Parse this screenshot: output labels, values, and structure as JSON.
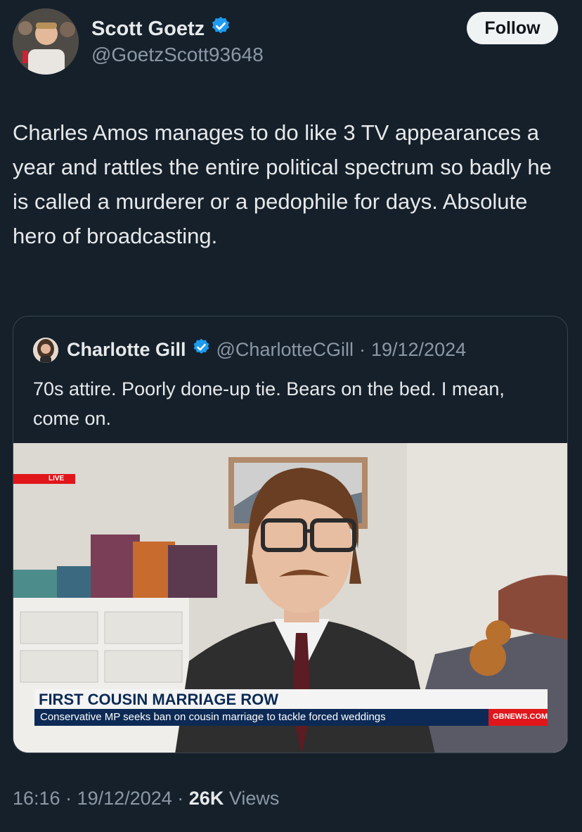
{
  "author": {
    "name": "Scott Goetz",
    "handle": "@GoetzScott93648",
    "verified_icon": "verified-badge-icon",
    "verified_color": "#1d9bf0"
  },
  "follow_label": "Follow",
  "tweet_text": "Charles Amos manages to do like 3 TV appearances a year and rattles the entire political spectrum so badly he is called a murderer or a pedophile for days. Absolute hero of broadcasting.",
  "quote": {
    "name": "Charlotte Gill",
    "handle": "@CharlotteCGill",
    "separator": "·",
    "date": "19/12/2024",
    "text": "70s attire. Poorly done-up tie. Bears on the bed. I mean, come on.",
    "media": {
      "live_label": "LIVE",
      "headline": "FIRST COUSIN MARRIAGE ROW",
      "ticker": "Conservative MP seeks ban on cousin marriage to tackle forced weddings",
      "channel": "GBNEWS.COM"
    }
  },
  "footer": {
    "time": "16:16",
    "sep1": "·",
    "date": "19/12/2024",
    "sep2": "·",
    "views_count": "26K",
    "views_label": "Views"
  },
  "colors": {
    "background": "#15202b",
    "text": "#e7e9ea",
    "muted": "#8b98a5",
    "border": "#38444d",
    "accent": "#1d9bf0",
    "live_red": "#e0161b"
  }
}
